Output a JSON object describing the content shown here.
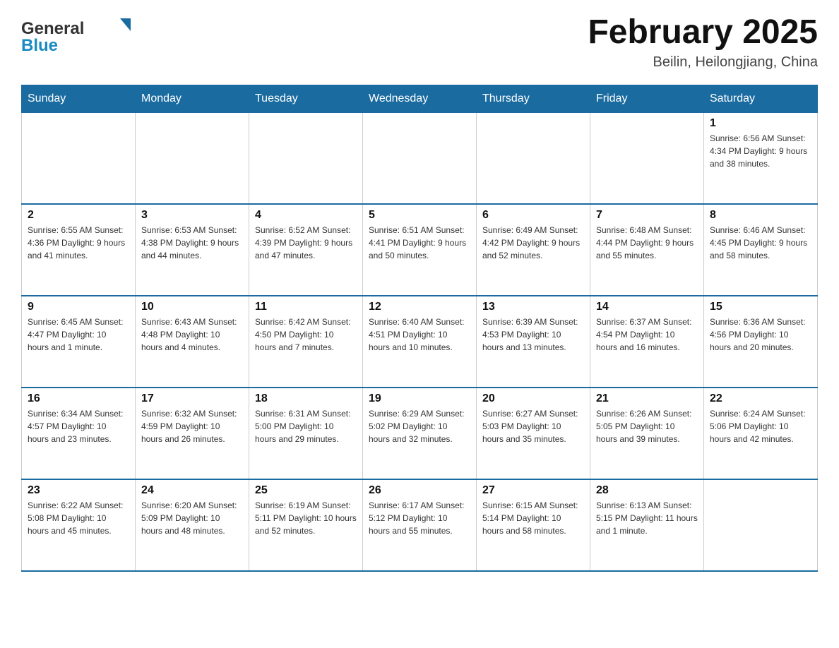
{
  "header": {
    "logo_general": "General",
    "logo_blue": "Blue",
    "month_title": "February 2025",
    "location": "Beilin, Heilongjiang, China"
  },
  "weekdays": [
    "Sunday",
    "Monday",
    "Tuesday",
    "Wednesday",
    "Thursday",
    "Friday",
    "Saturday"
  ],
  "weeks": [
    [
      {
        "day": "",
        "info": ""
      },
      {
        "day": "",
        "info": ""
      },
      {
        "day": "",
        "info": ""
      },
      {
        "day": "",
        "info": ""
      },
      {
        "day": "",
        "info": ""
      },
      {
        "day": "",
        "info": ""
      },
      {
        "day": "1",
        "info": "Sunrise: 6:56 AM\nSunset: 4:34 PM\nDaylight: 9 hours\nand 38 minutes."
      }
    ],
    [
      {
        "day": "2",
        "info": "Sunrise: 6:55 AM\nSunset: 4:36 PM\nDaylight: 9 hours\nand 41 minutes."
      },
      {
        "day": "3",
        "info": "Sunrise: 6:53 AM\nSunset: 4:38 PM\nDaylight: 9 hours\nand 44 minutes."
      },
      {
        "day": "4",
        "info": "Sunrise: 6:52 AM\nSunset: 4:39 PM\nDaylight: 9 hours\nand 47 minutes."
      },
      {
        "day": "5",
        "info": "Sunrise: 6:51 AM\nSunset: 4:41 PM\nDaylight: 9 hours\nand 50 minutes."
      },
      {
        "day": "6",
        "info": "Sunrise: 6:49 AM\nSunset: 4:42 PM\nDaylight: 9 hours\nand 52 minutes."
      },
      {
        "day": "7",
        "info": "Sunrise: 6:48 AM\nSunset: 4:44 PM\nDaylight: 9 hours\nand 55 minutes."
      },
      {
        "day": "8",
        "info": "Sunrise: 6:46 AM\nSunset: 4:45 PM\nDaylight: 9 hours\nand 58 minutes."
      }
    ],
    [
      {
        "day": "9",
        "info": "Sunrise: 6:45 AM\nSunset: 4:47 PM\nDaylight: 10 hours\nand 1 minute."
      },
      {
        "day": "10",
        "info": "Sunrise: 6:43 AM\nSunset: 4:48 PM\nDaylight: 10 hours\nand 4 minutes."
      },
      {
        "day": "11",
        "info": "Sunrise: 6:42 AM\nSunset: 4:50 PM\nDaylight: 10 hours\nand 7 minutes."
      },
      {
        "day": "12",
        "info": "Sunrise: 6:40 AM\nSunset: 4:51 PM\nDaylight: 10 hours\nand 10 minutes."
      },
      {
        "day": "13",
        "info": "Sunrise: 6:39 AM\nSunset: 4:53 PM\nDaylight: 10 hours\nand 13 minutes."
      },
      {
        "day": "14",
        "info": "Sunrise: 6:37 AM\nSunset: 4:54 PM\nDaylight: 10 hours\nand 16 minutes."
      },
      {
        "day": "15",
        "info": "Sunrise: 6:36 AM\nSunset: 4:56 PM\nDaylight: 10 hours\nand 20 minutes."
      }
    ],
    [
      {
        "day": "16",
        "info": "Sunrise: 6:34 AM\nSunset: 4:57 PM\nDaylight: 10 hours\nand 23 minutes."
      },
      {
        "day": "17",
        "info": "Sunrise: 6:32 AM\nSunset: 4:59 PM\nDaylight: 10 hours\nand 26 minutes."
      },
      {
        "day": "18",
        "info": "Sunrise: 6:31 AM\nSunset: 5:00 PM\nDaylight: 10 hours\nand 29 minutes."
      },
      {
        "day": "19",
        "info": "Sunrise: 6:29 AM\nSunset: 5:02 PM\nDaylight: 10 hours\nand 32 minutes."
      },
      {
        "day": "20",
        "info": "Sunrise: 6:27 AM\nSunset: 5:03 PM\nDaylight: 10 hours\nand 35 minutes."
      },
      {
        "day": "21",
        "info": "Sunrise: 6:26 AM\nSunset: 5:05 PM\nDaylight: 10 hours\nand 39 minutes."
      },
      {
        "day": "22",
        "info": "Sunrise: 6:24 AM\nSunset: 5:06 PM\nDaylight: 10 hours\nand 42 minutes."
      }
    ],
    [
      {
        "day": "23",
        "info": "Sunrise: 6:22 AM\nSunset: 5:08 PM\nDaylight: 10 hours\nand 45 minutes."
      },
      {
        "day": "24",
        "info": "Sunrise: 6:20 AM\nSunset: 5:09 PM\nDaylight: 10 hours\nand 48 minutes."
      },
      {
        "day": "25",
        "info": "Sunrise: 6:19 AM\nSunset: 5:11 PM\nDaylight: 10 hours\nand 52 minutes."
      },
      {
        "day": "26",
        "info": "Sunrise: 6:17 AM\nSunset: 5:12 PM\nDaylight: 10 hours\nand 55 minutes."
      },
      {
        "day": "27",
        "info": "Sunrise: 6:15 AM\nSunset: 5:14 PM\nDaylight: 10 hours\nand 58 minutes."
      },
      {
        "day": "28",
        "info": "Sunrise: 6:13 AM\nSunset: 5:15 PM\nDaylight: 11 hours\nand 1 minute."
      },
      {
        "day": "",
        "info": ""
      }
    ]
  ]
}
